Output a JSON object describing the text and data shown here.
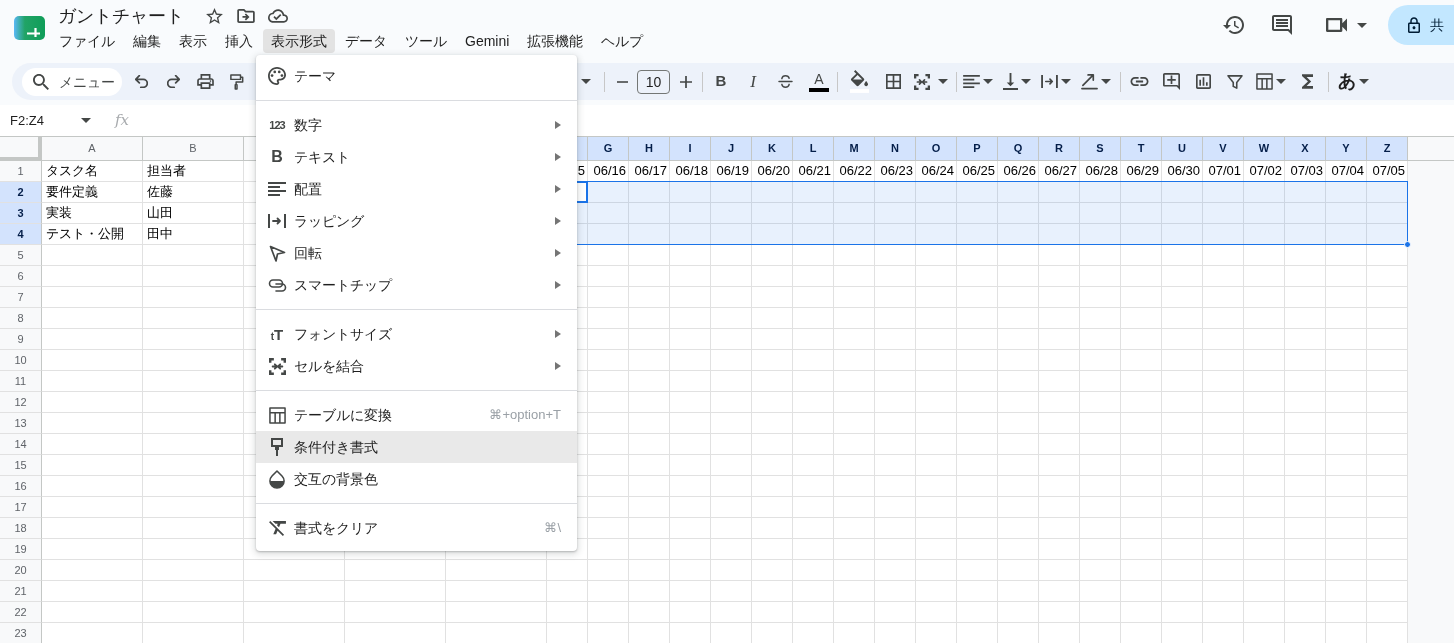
{
  "document": {
    "title": "ガントチャート"
  },
  "menubar": [
    {
      "label": "ファイル",
      "selected": false
    },
    {
      "label": "編集",
      "selected": false
    },
    {
      "label": "表示",
      "selected": false
    },
    {
      "label": "挿入",
      "selected": false
    },
    {
      "label": "表示形式",
      "selected": true
    },
    {
      "label": "データ",
      "selected": false
    },
    {
      "label": "ツール",
      "selected": false
    },
    {
      "label": "Gemini",
      "selected": false
    },
    {
      "label": "拡張機能",
      "selected": false
    },
    {
      "label": "ヘルプ",
      "selected": false
    }
  ],
  "share_button": {
    "label": "共"
  },
  "toolbar": {
    "search": {
      "placeholder": "メニュー"
    },
    "font_size": "10",
    "bold": "B",
    "italic": "I",
    "text_color": "A",
    "input_tools": "あ"
  },
  "formula_bar": {
    "name_box": "F2:Z4",
    "function_glyph": "fx"
  },
  "grid": {
    "columns": [
      {
        "label": "A",
        "selected": false
      },
      {
        "label": "B",
        "selected": false
      },
      {
        "selected": false
      },
      {},
      {},
      {
        "selected": true
      },
      {
        "label": "G",
        "selected": true
      },
      {
        "label": "H",
        "selected": true
      },
      {
        "label": "I",
        "selected": true
      },
      {
        "label": "J",
        "selected": true
      },
      {
        "label": "K",
        "selected": true
      },
      {
        "label": "L",
        "selected": true
      },
      {
        "label": "M",
        "selected": true
      },
      {
        "label": "N",
        "selected": true
      },
      {
        "label": "O",
        "selected": true
      },
      {
        "label": "P",
        "selected": true
      },
      {
        "label": "Q",
        "selected": true
      },
      {
        "label": "R",
        "selected": true
      },
      {
        "label": "S",
        "selected": true
      },
      {
        "label": "T",
        "selected": true
      },
      {
        "label": "U",
        "selected": true
      },
      {
        "label": "V",
        "selected": true
      },
      {
        "label": "W",
        "selected": true
      },
      {
        "label": "X",
        "selected": true
      },
      {
        "label": "Y",
        "selected": true
      },
      {
        "label": "Z",
        "selected": true
      }
    ],
    "rows": [
      {
        "label": "1",
        "selected": false,
        "cells": [
          "タスク名",
          "担当者",
          null,
          null,
          null,
          "5",
          "06/16",
          "06/17",
          "06/18",
          "06/19",
          "06/20",
          "06/21",
          "06/22",
          "06/23",
          "06/24",
          "06/25",
          "06/26",
          "06/27",
          "06/28",
          "06/29",
          "06/30",
          "07/01",
          "07/02",
          "07/03",
          "07/04",
          "07/05"
        ]
      },
      {
        "label": "2",
        "selected": true,
        "cells": [
          "要件定義",
          "佐藤"
        ]
      },
      {
        "label": "3",
        "selected": true,
        "cells": [
          "実装",
          "山田"
        ]
      },
      {
        "label": "4",
        "selected": true,
        "cells": [
          "テスト・公開",
          "田中"
        ]
      },
      {
        "label": "5",
        "selected": false
      },
      {
        "label": "6",
        "selected": false
      },
      {
        "label": "7",
        "selected": false
      },
      {
        "label": "8",
        "selected": false
      },
      {
        "label": "9",
        "selected": false
      },
      {
        "label": "10",
        "selected": false
      },
      {
        "label": "11",
        "selected": false
      },
      {
        "label": "12",
        "selected": false
      },
      {
        "label": "13",
        "selected": false
      },
      {
        "label": "14",
        "selected": false
      },
      {
        "label": "15",
        "selected": false
      },
      {
        "label": "16",
        "selected": false
      },
      {
        "label": "17",
        "selected": false
      },
      {
        "label": "18",
        "selected": false
      },
      {
        "label": "19",
        "selected": false
      },
      {
        "label": "20",
        "selected": false
      },
      {
        "label": "21",
        "selected": false
      },
      {
        "label": "22",
        "selected": false
      },
      {
        "label": "23",
        "selected": false
      }
    ]
  },
  "format_menu": {
    "sections": [
      [
        {
          "label": "テーマ",
          "submenu": false,
          "highlighted": false
        }
      ],
      [
        {
          "label": "数字",
          "glyph": "123",
          "submenu": true,
          "highlighted": false
        },
        {
          "label": "テキスト",
          "glyph": "B",
          "submenu": true,
          "highlighted": false
        },
        {
          "label": "配置",
          "submenu": true,
          "highlighted": false
        },
        {
          "label": "ラッピング",
          "submenu": true,
          "highlighted": false
        },
        {
          "label": "回転",
          "submenu": true,
          "highlighted": false
        },
        {
          "label": "スマートチップ",
          "submenu": true,
          "highlighted": false
        }
      ],
      [
        {
          "label": "フォントサイズ",
          "glyph": "tT",
          "submenu": true,
          "highlighted": false
        },
        {
          "label": "セルを結合",
          "submenu": true,
          "highlighted": false
        }
      ],
      [
        {
          "label": "テーブルに変換",
          "shortcut": "⌘+option+T",
          "submenu": false,
          "highlighted": false
        },
        {
          "label": "条件付き書式",
          "submenu": false,
          "highlighted": true
        },
        {
          "label": "交互の背景色",
          "submenu": false,
          "highlighted": false
        }
      ],
      [
        {
          "label": "書式をクリア",
          "shortcut": "⌘\\",
          "submenu": false,
          "highlighted": false
        }
      ]
    ]
  }
}
